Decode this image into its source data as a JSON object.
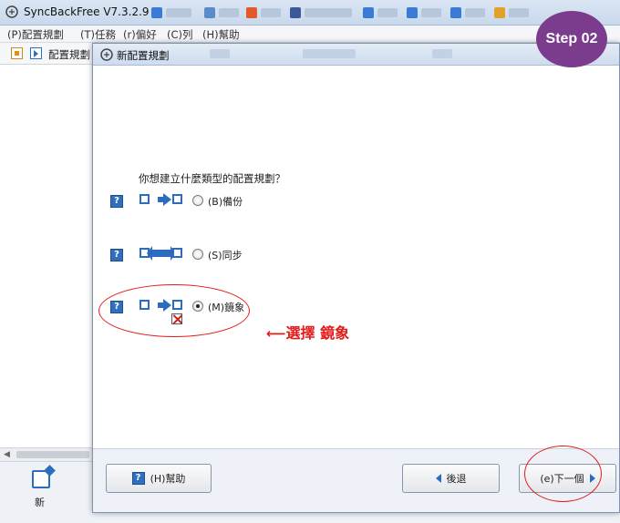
{
  "app": {
    "title": "SyncBackFree V7.3.2.9"
  },
  "menu": {
    "items": [
      "(P)配置規劃",
      "(T)任務",
      "(r)偏好",
      "(C)列",
      "(H)幫助"
    ]
  },
  "toolbar": {
    "panel_label": "配置規劃"
  },
  "bottom": {
    "new_label": "新"
  },
  "dialog": {
    "title": "新配置規劃",
    "question": "你想建立什麼類型的配置規劃？",
    "options": [
      {
        "label": "(B)備份",
        "selected": false,
        "icon": "backup-icon"
      },
      {
        "label": "(S)同步",
        "selected": false,
        "icon": "sync-icon"
      },
      {
        "label": "(M)鏡象",
        "selected": true,
        "icon": "mirror-icon"
      }
    ],
    "annotation": "選擇 鏡象",
    "buttons": {
      "help": "(H)幫助",
      "back": "後退",
      "next": "(e)下一個"
    }
  },
  "badge": {
    "step": "Step 02"
  },
  "colors": {
    "accent_blue": "#2b6cc0",
    "annotation_red": "#e31b1b",
    "badge_purple": "#7b3c8e"
  }
}
